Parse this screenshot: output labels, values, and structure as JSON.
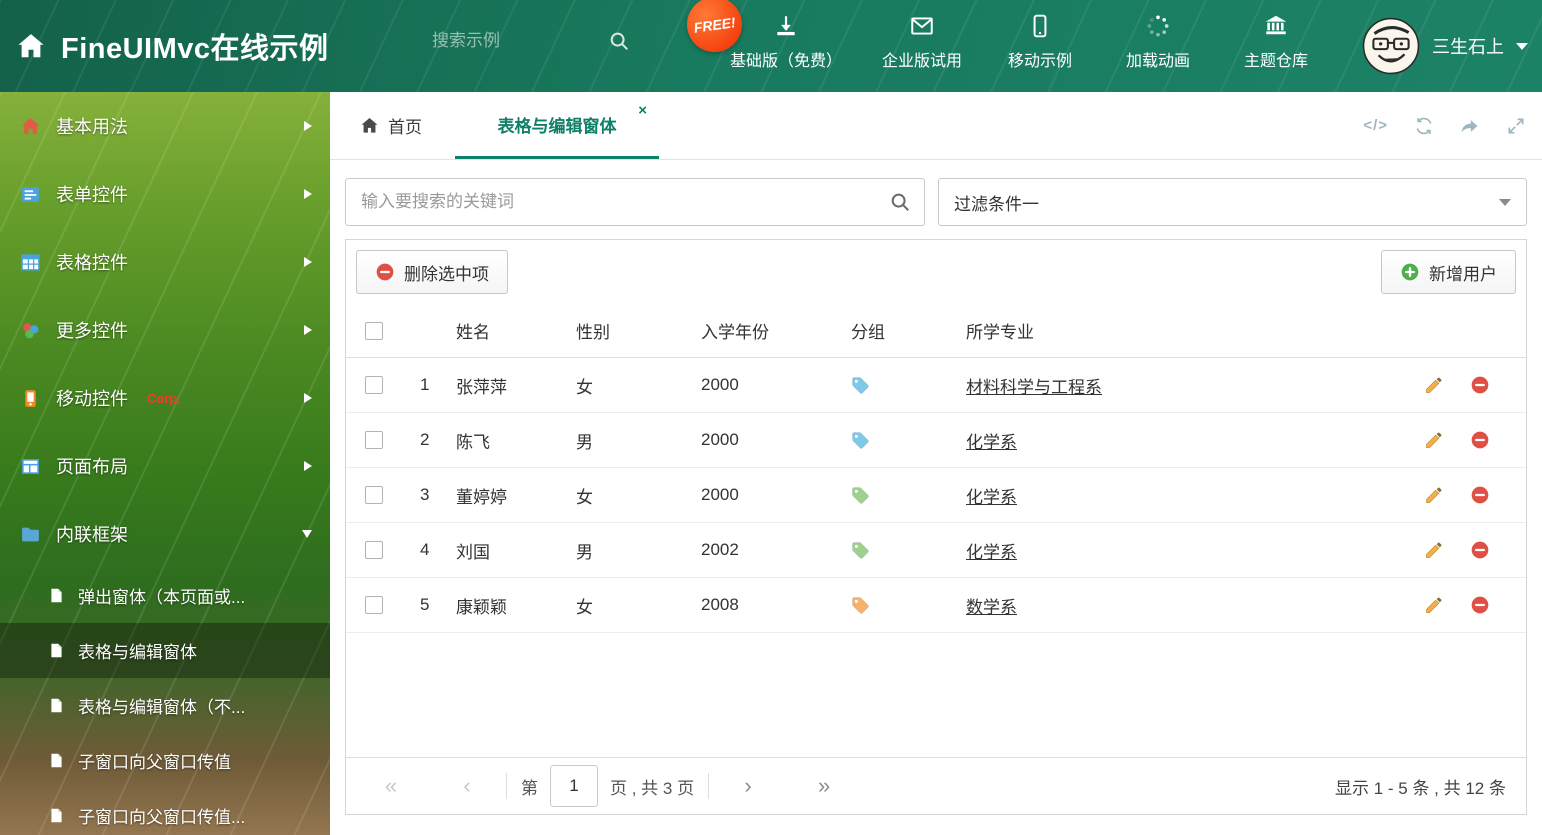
{
  "colors": {
    "accent": "#0e7f68",
    "header_green": "#187a5e",
    "danger": "#e04f43",
    "success": "#4fae4e",
    "tag_blue": "#7ec8ea",
    "tag_green": "#9fd08d",
    "tag_orange": "#f6b26b"
  },
  "glyphs": {
    "code": "</>",
    "close_tab": "×"
  },
  "icons": [
    "home-icon",
    "search-icon",
    "download-icon",
    "envelope-icon",
    "mobile-icon",
    "spinner-icon",
    "bank-icon",
    "avatar",
    "file-icon",
    "tag-icon",
    "edit-pencil-icon",
    "delete-minus-icon",
    "add-plus-icon",
    "refresh-icon",
    "forward-icon",
    "expand-icon",
    "code-icon"
  ],
  "header": {
    "title": "FineUIMvc在线示例",
    "search_placeholder": "搜索示例",
    "free_badge": "FREE!",
    "nav": [
      {
        "label": "基础版（免费）"
      },
      {
        "label": "企业版试用"
      },
      {
        "label": "移动示例"
      },
      {
        "label": "加载动画"
      },
      {
        "label": "主题仓库"
      }
    ],
    "user": "三生石上"
  },
  "sidebar": {
    "items": [
      {
        "label": "基本用法"
      },
      {
        "label": "表单控件"
      },
      {
        "label": "表格控件"
      },
      {
        "label": "更多控件"
      },
      {
        "label": "移动控件",
        "badge": "Corp."
      },
      {
        "label": "页面布局"
      },
      {
        "label": "内联框架"
      }
    ],
    "subitems": [
      {
        "label": "弹出窗体（本页面或..."
      },
      {
        "label": "表格与编辑窗体"
      },
      {
        "label": "表格与编辑窗体（不..."
      },
      {
        "label": "子窗口向父窗口传值"
      },
      {
        "label": "子窗口向父窗口传值..."
      }
    ]
  },
  "tabs": {
    "home": "首页",
    "active": "表格与编辑窗体"
  },
  "filters": {
    "search_placeholder": "输入要搜索的关键词",
    "filter_selected": "过滤条件一"
  },
  "toolbar": {
    "delete_label": "删除选中项",
    "add_label": "新增用户"
  },
  "table": {
    "headers": {
      "name": "姓名",
      "gender": "性别",
      "year": "入学年份",
      "group": "分组",
      "major": "所学专业"
    },
    "rows": [
      {
        "index": "1",
        "name": "张萍萍",
        "gender": "女",
        "year": "2000",
        "tag_color": "#7ec8ea",
        "major": "材料科学与工程系"
      },
      {
        "index": "2",
        "name": "陈飞",
        "gender": "男",
        "year": "2000",
        "tag_color": "#7ec8ea",
        "major": "化学系"
      },
      {
        "index": "3",
        "name": "董婷婷",
        "gender": "女",
        "year": "2000",
        "tag_color": "#9fd08d",
        "major": "化学系"
      },
      {
        "index": "4",
        "name": "刘国",
        "gender": "男",
        "year": "2002",
        "tag_color": "#9fd08d",
        "major": "化学系"
      },
      {
        "index": "5",
        "name": "康颖颖",
        "gender": "女",
        "year": "2008",
        "tag_color": "#f6b26b",
        "major": "数学系"
      }
    ]
  },
  "pagination": {
    "first": "«",
    "prev": "‹",
    "label_page": "第",
    "page_value": "1",
    "label_total": "页 , 共 3 页",
    "next": "›",
    "last": "»",
    "summary": "显示 1 - 5 条 , 共 12 条"
  }
}
